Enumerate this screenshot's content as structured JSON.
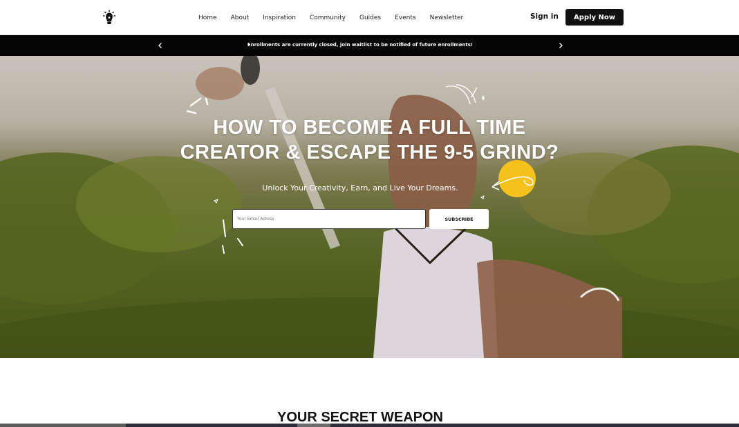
{
  "header": {
    "logo_icon": "lightbulb-logo-icon",
    "nav": [
      "Home",
      "About",
      "Inspiration",
      "Community",
      "Guides",
      "Events",
      "Newsletter"
    ],
    "signin_label": "Sign in",
    "apply_label": "Apply Now"
  },
  "announcement": {
    "text": "Enrollments are currently closed, join waitlist to be notified of future enrollments!",
    "prev_icon": "chevron-left-icon",
    "next_icon": "chevron-right-icon"
  },
  "hero": {
    "title_line1": "HOW TO BECOME A FULL TIME",
    "title_line2": "CREATOR & ESCAPE THE 9-5 GRIND?",
    "subtitle": "Unlock Your Creativity, Earn, and Live Your Dreams.",
    "email_placeholder": "Your Email Adress",
    "subscribe_label": "SUBSCRIBE"
  },
  "section": {
    "title": "YOUR SECRET WEAPON"
  },
  "colors": {
    "primary_dark": "#111111",
    "accent_yellow": "#f5c11c",
    "bar_black": "#050505"
  }
}
